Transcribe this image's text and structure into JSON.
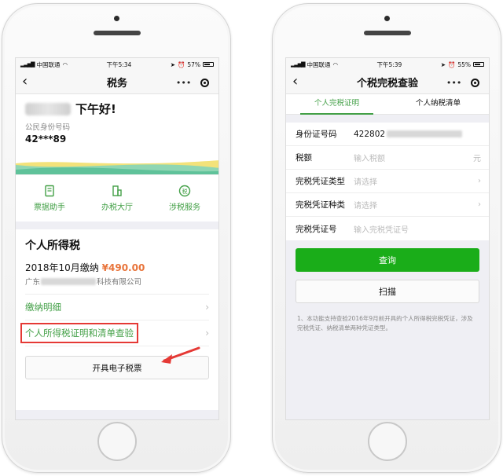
{
  "left": {
    "status": {
      "carrier": "中国联通",
      "time": "下午5:34",
      "battery": "57%"
    },
    "nav": {
      "title": "税务",
      "more": "•••"
    },
    "greeting": "下午好!",
    "id_label": "公民身份号码",
    "id_value": "42***89",
    "services": [
      {
        "label": "票据助手",
        "icon": "receipt-icon"
      },
      {
        "label": "办税大厅",
        "icon": "building-icon"
      },
      {
        "label": "涉税服务",
        "icon": "tax-badge-icon"
      }
    ],
    "tax": {
      "title": "个人所得税",
      "pay_text": "2018年10月缴纳",
      "pay_amount": "¥490.00",
      "company_prefix": "广东",
      "company_suffix": "科技有限公司",
      "link_detail": "缴纳明细",
      "link_certificate": "个人所得税证明和清单查验",
      "btn_e_ticket": "开具电子税票",
      "chevron": "›"
    }
  },
  "right": {
    "status": {
      "carrier": "中国联通",
      "time": "下午5:39",
      "battery": "55%"
    },
    "nav": {
      "title": "个税完税查验",
      "more": "•••"
    },
    "tabs": [
      "个人完税证明",
      "个人纳税清单"
    ],
    "form": {
      "id_label": "身份证号码",
      "id_value": "422802",
      "amount_label": "税额",
      "amount_placeholder": "输入税额",
      "amount_unit": "元",
      "voucher_type_label": "完税凭证类型",
      "voucher_type_placeholder": "请选择",
      "voucher_kind_label": "完税凭证种类",
      "voucher_kind_placeholder": "请选择",
      "voucher_no_label": "完税凭证号",
      "voucher_no_placeholder": "输入完税凭证号",
      "chevron": "›"
    },
    "btn_query": "查询",
    "btn_scan": "扫描",
    "note": "1、本功能支持查验2016年9月前开具的个人所得税完税凭证，涉及完税凭证、纳税清单两种凭证类型。"
  },
  "colors": {
    "accent": "#1aad19",
    "link_green": "#43a047",
    "amount_orange": "#e8743b",
    "highlight_red": "#e53935"
  }
}
